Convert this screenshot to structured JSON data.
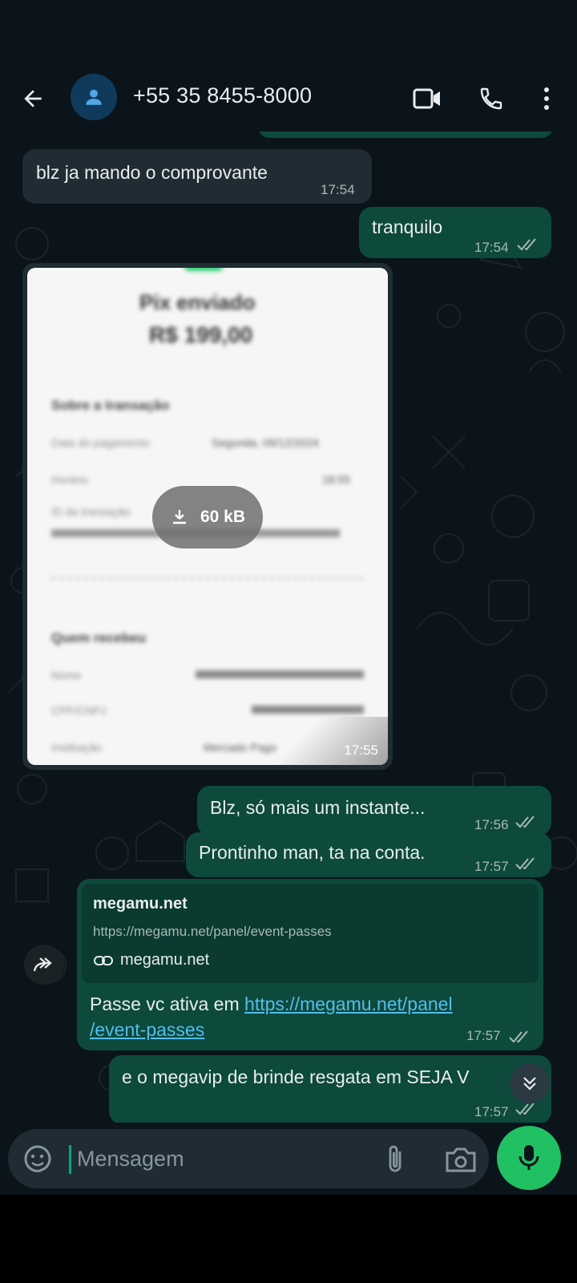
{
  "header": {
    "contact_name": "+55 35 8455-8000"
  },
  "messages": {
    "m1": {
      "text": "blz ja mando o comprovante",
      "time": "17:54"
    },
    "m2": {
      "text": "tranquilo",
      "time": "17:54"
    },
    "image": {
      "download_size": "60 kB",
      "time": "17:55",
      "blurred_lines": [
        "Pix enviado",
        "R$ 199,00",
        "Sobre a transação",
        "Data do pagamento",
        "Segunda, 09/12/2024",
        "Horário",
        "18:55",
        "ID da transação",
        "Quem recebeu",
        "Nome",
        "CPF/CNPJ",
        "Instituição",
        "Mercado Pago"
      ]
    },
    "m3": {
      "text": "Blz, só mais um instante...",
      "time": "17:56"
    },
    "m4": {
      "text": "Prontinho man, ta na conta.",
      "time": "17:57"
    },
    "link": {
      "preview_title": "megamu.net",
      "preview_url": "https://megamu.net/panel/event-passes",
      "preview_domain": "megamu.net",
      "text_prefix": "Passe vc ativa em ",
      "link_line1": "https://megamu.net/panel",
      "link_line2": "/event-passes",
      "time": "17:57"
    },
    "m5": {
      "text": "e o megavip de brinde resgata em SEJA V",
      "time": "17:57"
    }
  },
  "composer": {
    "placeholder": "Mensagem"
  },
  "icons": [
    "back-arrow-icon",
    "avatar-person-icon",
    "video-call-icon",
    "phone-icon",
    "more-vert-icon",
    "download-icon",
    "link-icon",
    "forward-icon",
    "double-chevron-down-icon",
    "sticker-icon",
    "paperclip-icon",
    "camera-icon",
    "mic-icon",
    "double-check-icon"
  ],
  "colors": {
    "background": "#0b141a",
    "incoming_bubble": "#202c33",
    "outgoing_bubble": "#0d4a3c",
    "accent_green": "#21c063",
    "link_blue": "#53bdeb"
  }
}
